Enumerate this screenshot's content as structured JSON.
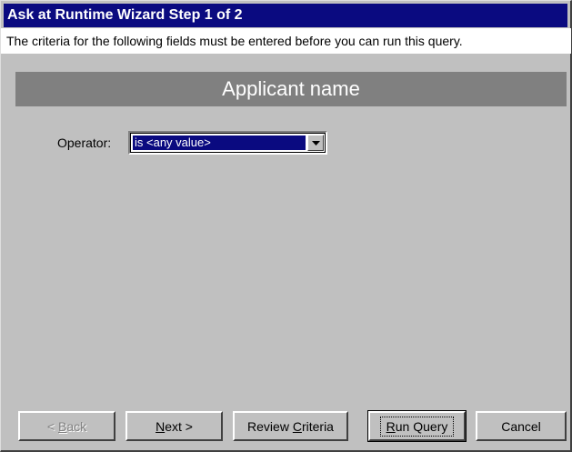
{
  "window": {
    "title": "Ask at Runtime Wizard Step 1 of 2",
    "instruction": "The criteria for the following fields must be entered before you can run this query."
  },
  "section": {
    "header": "Applicant name"
  },
  "criteria": {
    "operator_label": "Operator:",
    "operator_value": "is <any value>",
    "dropdown_icon": "chevron-down-icon"
  },
  "buttons": {
    "back": {
      "prefix": "< ",
      "mnemonic": "B",
      "rest": "ack",
      "enabled": false
    },
    "next": {
      "mnemonic": "N",
      "rest": "ext >",
      "enabled": true
    },
    "review": {
      "prefix": "Review ",
      "mnemonic": "C",
      "rest": "riteria",
      "enabled": true
    },
    "run": {
      "mnemonic": "R",
      "rest": "un Query",
      "enabled": true,
      "focused": true
    },
    "cancel": {
      "label": "Cancel",
      "enabled": true
    }
  },
  "colors": {
    "titlebar": "#0a0a80",
    "face": "#c0c0c0",
    "header_band": "#808080",
    "selection": "#0a0a80"
  }
}
